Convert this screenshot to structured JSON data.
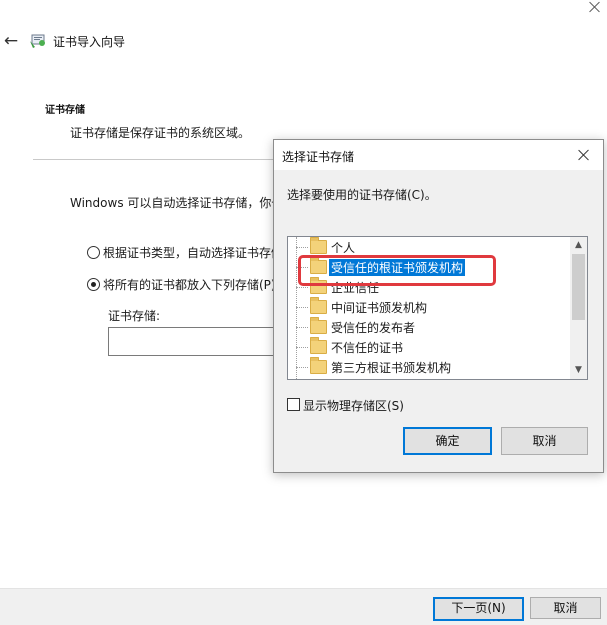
{
  "wizard": {
    "title": "证书导入向导",
    "section_heading": "证书存储",
    "section_desc": "证书存储是保存证书的系统区域。",
    "auto_text": "Windows 可以自动选择证书存储，你也",
    "option_auto": "根据证书类型，自动选择证书存储",
    "option_manual": "将所有的证书都放入下列存储(P)",
    "store_label": "证书存储:",
    "store_value": "",
    "next_button": "下一页(N)",
    "cancel_button": "取消"
  },
  "dialog": {
    "title": "选择证书存储",
    "prompt": "选择要使用的证书存储(C)。",
    "stores": [
      {
        "label": "个人",
        "selected": false
      },
      {
        "label": "受信任的根证书颁发机构",
        "selected": true
      },
      {
        "label": "企业信任",
        "selected": false
      },
      {
        "label": "中间证书颁发机构",
        "selected": false
      },
      {
        "label": "受信任的发布者",
        "selected": false
      },
      {
        "label": "不信任的证书",
        "selected": false
      },
      {
        "label": "第三方根证书颁发机构",
        "selected": false
      }
    ],
    "show_physical": "显示物理存储区(S)",
    "ok_button": "确定",
    "cancel_button": "取消"
  },
  "colors": {
    "selection": "#0078d7",
    "highlight_annotation": "#e0393e"
  }
}
